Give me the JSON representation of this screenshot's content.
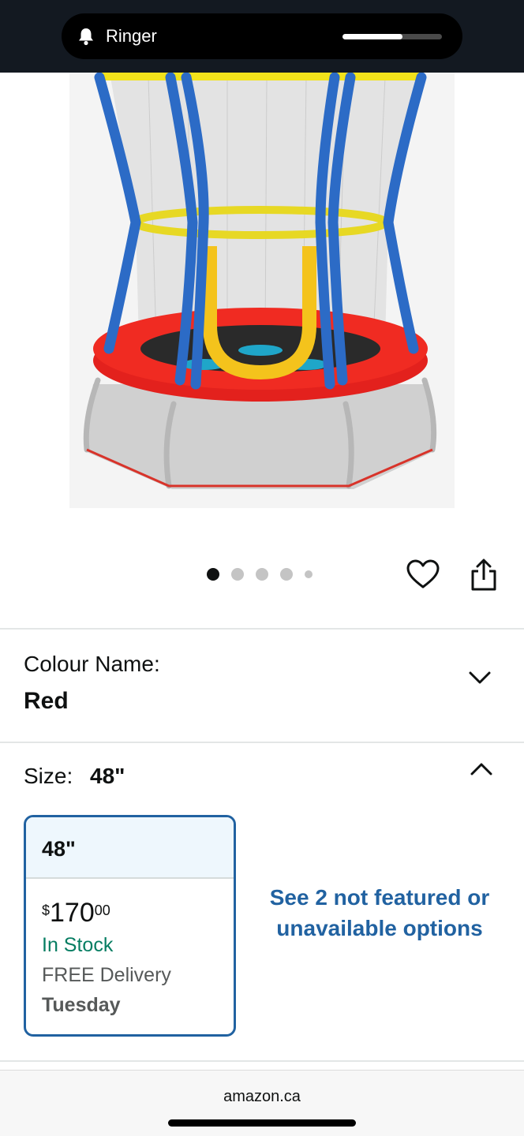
{
  "status_bar": {
    "ringer_label": "Ringer",
    "volume_level": 0.6
  },
  "product_image": {
    "alt": "Red trampoline with blue poles, yellow rings and safety net"
  },
  "carousel": {
    "image_count": 5,
    "active_index": 0
  },
  "colour": {
    "label": "Colour Name:",
    "value": "Red"
  },
  "size": {
    "label": "Size:",
    "value": "48\"",
    "card": {
      "title": "48\"",
      "price_currency": "$",
      "price_whole": "170",
      "price_fraction": "00",
      "stock": "In Stock",
      "delivery": "FREE Delivery",
      "delivery_day": "Tuesday"
    },
    "more_options": "See 2 not featured or unavailable options"
  },
  "browser": {
    "url": "amazon.ca"
  },
  "colors": {
    "header_bg": "#131921",
    "link_blue": "#2162a1",
    "stock_green": "#067d62",
    "selected_card_bg": "#eef7fd"
  },
  "icons": [
    "bell-icon",
    "heart-icon",
    "share-icon",
    "chevron-down-icon",
    "chevron-up-icon"
  ]
}
